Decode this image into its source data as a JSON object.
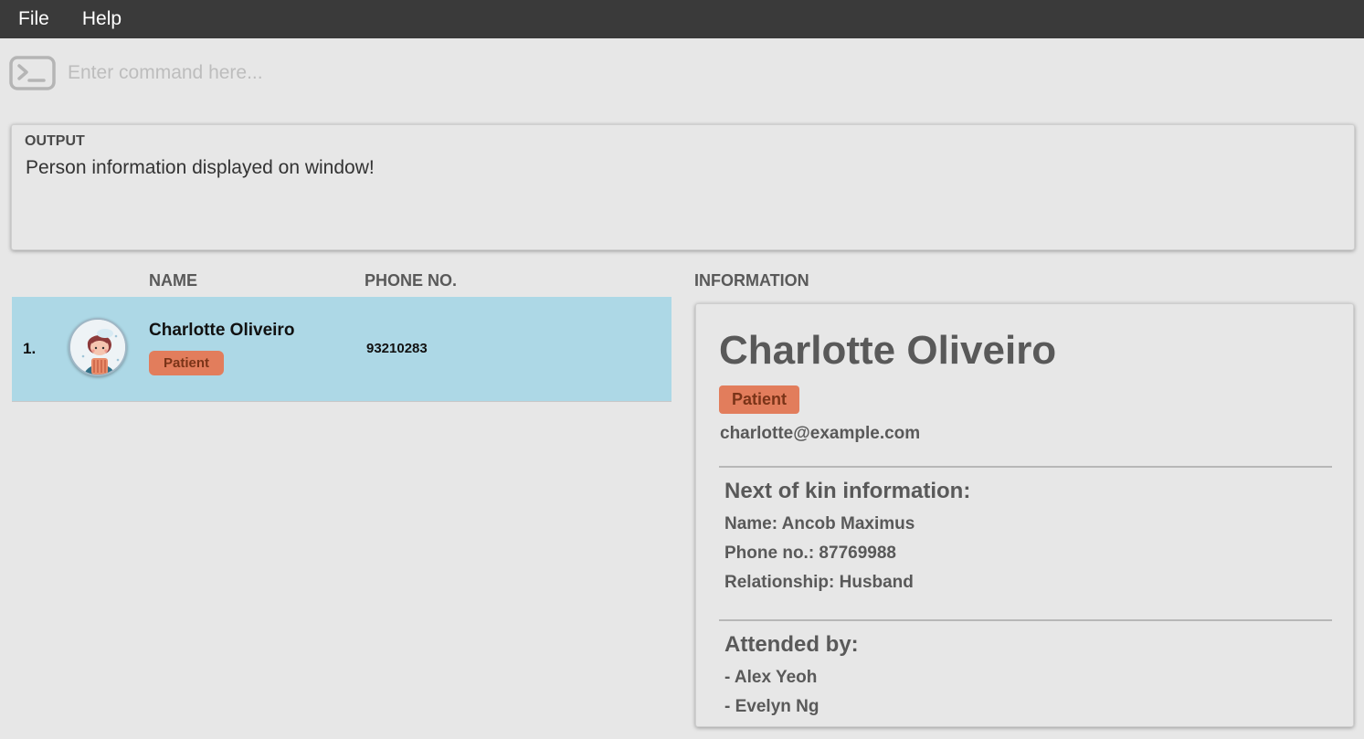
{
  "menu": {
    "file": "File",
    "help": "Help"
  },
  "command": {
    "placeholder": "Enter command here...",
    "icon": "terminal-icon"
  },
  "output": {
    "title": "OUTPUT",
    "message": "Person information displayed on window!"
  },
  "list": {
    "headers": {
      "name": "NAME",
      "phone": "PHONE NO."
    },
    "persons": [
      {
        "index": "1.",
        "name": "Charlotte Oliveiro",
        "tag": "Patient",
        "phone": "93210283"
      }
    ]
  },
  "info": {
    "header": "INFORMATION",
    "name": "Charlotte Oliveiro",
    "tag": "Patient",
    "email": "charlotte@example.com",
    "kin": {
      "title": "Next of kin information:",
      "name": "Name: Ancob Maximus",
      "phone": "Phone no.: 87769988",
      "relationship": "Relationship: Husband"
    },
    "attended": {
      "title": "Attended by:",
      "people": [
        "- Alex Yeoh",
        "- Evelyn Ng"
      ]
    }
  },
  "colors": {
    "menubar": "#3a3a3a",
    "background": "#e7e7e7",
    "selected_row": "#add8e6",
    "tag": "#e27d5c"
  }
}
